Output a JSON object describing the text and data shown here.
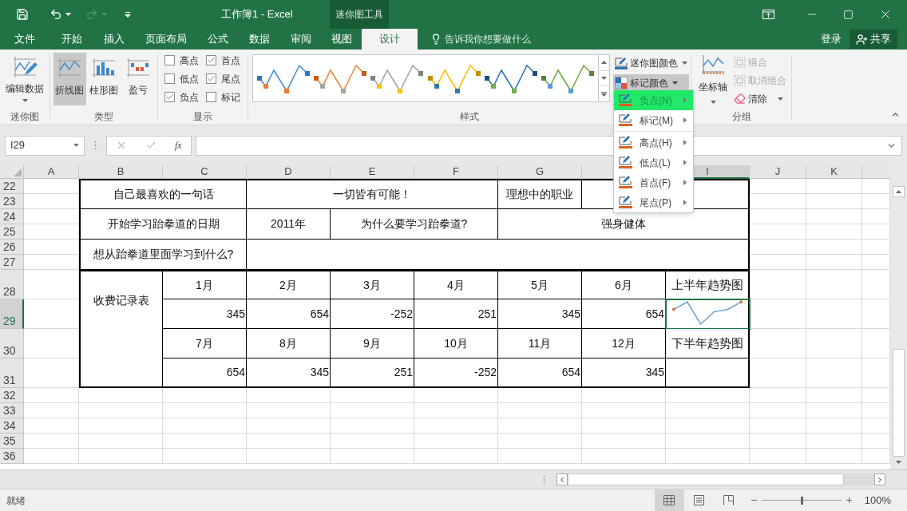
{
  "title_bar": {
    "title": "工作簿1 - Excel",
    "context_tab": "迷你图工具"
  },
  "menu_tabs": [
    {
      "label": "文件",
      "selected": false
    },
    {
      "label": "开始",
      "selected": false
    },
    {
      "label": "插入",
      "selected": false
    },
    {
      "label": "页面布局",
      "selected": false
    },
    {
      "label": "公式",
      "selected": false
    },
    {
      "label": "数据",
      "selected": false
    },
    {
      "label": "审阅",
      "selected": false
    },
    {
      "label": "视图",
      "selected": false
    },
    {
      "label": "设计",
      "selected": true
    }
  ],
  "tell_me": {
    "placeholder": "告诉我你想要做什么"
  },
  "account": {
    "sign_in": "登录",
    "share": "共享"
  },
  "ribbon": {
    "sparkline_group": {
      "edit_data": "编辑数据",
      "label": "迷你图"
    },
    "type_group": {
      "label": "类型",
      "types": [
        {
          "label": "折线图",
          "selected": true
        },
        {
          "label": "柱形图",
          "selected": false
        },
        {
          "label": "盈亏",
          "selected": false
        }
      ]
    },
    "show_group": {
      "label": "显示",
      "options": [
        {
          "label": "高点",
          "checked": false
        },
        {
          "label": "首点",
          "checked": true
        },
        {
          "label": "低点",
          "checked": false
        },
        {
          "label": "尾点",
          "checked": true
        },
        {
          "label": "负点",
          "checked": true
        },
        {
          "label": "标记",
          "checked": false
        }
      ]
    },
    "style_group": {
      "label": "样式",
      "styles": [
        {
          "color": "#4a8fc9",
          "markers": [
            {
              "color": "#2e75b6"
            },
            {
              "color": "#ed7d31"
            },
            {
              "color": "#ed7d31"
            },
            {
              "color": "#2e75b6"
            }
          ]
        },
        {
          "color": "#ed8a3f",
          "markers": [
            {
              "color": "#c55a11"
            },
            {
              "color": "#a5a5a5"
            },
            {
              "color": "#a5a5a5"
            },
            {
              "color": "#c55a11"
            }
          ]
        },
        {
          "color": "#a5a5a5",
          "markers": [
            {
              "color": "#7f7f7f"
            },
            {
              "color": "#ffc000"
            },
            {
              "color": "#ffc000"
            },
            {
              "color": "#7f7f7f"
            }
          ]
        },
        {
          "color": "#ffc000",
          "markers": [
            {
              "color": "#bf9000"
            },
            {
              "color": "#2e75b6"
            },
            {
              "color": "#2e75b6"
            },
            {
              "color": "#bf9000"
            }
          ]
        },
        {
          "color": "#2e75b6",
          "markers": [
            {
              "color": "#1f4e79"
            },
            {
              "color": "#70ad47"
            },
            {
              "color": "#70ad47"
            },
            {
              "color": "#1f4e79"
            }
          ]
        },
        {
          "color": "#70ad47",
          "markers": [
            {
              "color": "#548235"
            },
            {
              "color": "#5b9bd5"
            },
            {
              "color": "#5b9bd5"
            },
            {
              "color": "#548235"
            }
          ]
        }
      ],
      "sparkline_color": "迷你图颜色",
      "marker_color": "标记颜色"
    },
    "group_group": {
      "label": "分组",
      "axis": "坐标轴",
      "commands": [
        {
          "label": "组合",
          "disabled": true
        },
        {
          "label": "取消组合",
          "disabled": true
        },
        {
          "label": "清除",
          "disabled": false
        }
      ]
    }
  },
  "formula_bar": {
    "name_box": "I29",
    "function_label": "fx"
  },
  "sheet": {
    "column_headers": [
      {
        "label": "A",
        "selected": false
      },
      {
        "label": "B",
        "selected": false
      },
      {
        "label": "C",
        "selected": false
      },
      {
        "label": "D",
        "selected": false
      },
      {
        "label": "E",
        "selected": false
      },
      {
        "label": "F",
        "selected": false
      },
      {
        "label": "G",
        "selected": false
      },
      {
        "label": "I",
        "selected": true
      },
      {
        "label": "J",
        "selected": false
      },
      {
        "label": "K",
        "selected": false
      }
    ],
    "row_headers": [
      {
        "label": "22",
        "selected": false
      },
      {
        "label": "23",
        "selected": false
      },
      {
        "label": "24",
        "selected": false
      },
      {
        "label": "25",
        "selected": false
      },
      {
        "label": "26",
        "selected": false
      },
      {
        "label": "27",
        "selected": false
      },
      {
        "label": "28",
        "selected": false
      },
      {
        "label": "29",
        "selected": true
      },
      {
        "label": "30",
        "selected": false
      },
      {
        "label": "31",
        "selected": false
      },
      {
        "label": "32",
        "selected": false
      },
      {
        "label": "33",
        "selected": false
      },
      {
        "label": "34",
        "selected": false
      },
      {
        "label": "35",
        "selected": false
      },
      {
        "label": "36",
        "selected": false
      }
    ],
    "cells": [
      {
        "text": "自己最喜欢的一句话"
      },
      {
        "text": "一切皆有可能！"
      },
      {
        "text": "理想中的职业"
      },
      {
        "text": "开始学习跆拳道的日期"
      },
      {
        "text": "2011年"
      },
      {
        "text": "为什么要学习跆拳道?"
      },
      {
        "text": "强身健体"
      },
      {
        "text": "想从跆拳道里面学习到什么?"
      },
      {
        "text": "收费记录表"
      },
      {
        "text": "1月"
      },
      {
        "text": "2月"
      },
      {
        "text": "3月"
      },
      {
        "text": "4月"
      },
      {
        "text": "5月"
      },
      {
        "text": "6月"
      },
      {
        "text": "上半年趋势图"
      },
      {
        "text": "345"
      },
      {
        "text": "654"
      },
      {
        "text": "-252"
      },
      {
        "text": "251"
      },
      {
        "text": "345"
      },
      {
        "text": "654"
      },
      {
        "kind": "sparkline",
        "selected": true
      },
      {
        "text": "7月"
      },
      {
        "text": "8月"
      },
      {
        "text": "9月"
      },
      {
        "text": "10月"
      },
      {
        "text": "11月"
      },
      {
        "text": "12月"
      },
      {
        "text": "下半年趋势图"
      },
      {
        "text": "654"
      },
      {
        "text": "345"
      },
      {
        "text": "251"
      },
      {
        "text": "-252"
      },
      {
        "text": "654"
      },
      {
        "text": "345"
      }
    ]
  },
  "marker_color_menu": [
    {
      "label": "负点(N)",
      "selected": true
    },
    {
      "label": "标记(M)",
      "selected": false
    },
    {
      "label": "高点(H)",
      "selected": false
    },
    {
      "label": "低点(L)",
      "selected": false
    },
    {
      "label": "首点(F)",
      "selected": false
    },
    {
      "label": "尾点(P)",
      "selected": false
    }
  ],
  "status_bar": {
    "status": "就绪",
    "zoom": "100%",
    "zoom_slider": {
      "level": 0.5
    }
  }
}
